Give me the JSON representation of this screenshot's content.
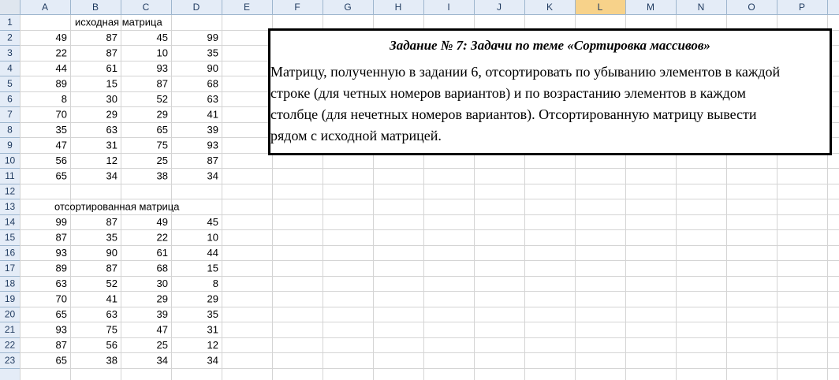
{
  "columns": [
    "A",
    "B",
    "C",
    "D",
    "E",
    "F",
    "G",
    "H",
    "I",
    "J",
    "K",
    "L",
    "M",
    "N",
    "O",
    "P"
  ],
  "selected_column": "L",
  "rows": [
    "1",
    "2",
    "3",
    "4",
    "5",
    "6",
    "7",
    "8",
    "9",
    "10",
    "11",
    "12",
    "13",
    "14",
    "15",
    "16",
    "17",
    "18",
    "19",
    "20",
    "21",
    "22",
    "23"
  ],
  "source_label": "исходная матрица",
  "source_matrix": [
    [
      49,
      87,
      45,
      99
    ],
    [
      22,
      87,
      10,
      35
    ],
    [
      44,
      61,
      93,
      90
    ],
    [
      89,
      15,
      87,
      68
    ],
    [
      8,
      30,
      52,
      63
    ],
    [
      70,
      29,
      29,
      41
    ],
    [
      35,
      63,
      65,
      39
    ],
    [
      47,
      31,
      75,
      93
    ],
    [
      56,
      12,
      25,
      87
    ],
    [
      65,
      34,
      38,
      34
    ]
  ],
  "sorted_label": "отсортированная матрица",
  "sorted_matrix": [
    [
      99,
      87,
      49,
      45
    ],
    [
      87,
      35,
      22,
      10
    ],
    [
      93,
      90,
      61,
      44
    ],
    [
      89,
      87,
      68,
      15
    ],
    [
      63,
      52,
      30,
      8
    ],
    [
      70,
      41,
      29,
      29
    ],
    [
      65,
      63,
      39,
      35
    ],
    [
      93,
      75,
      47,
      31
    ],
    [
      87,
      56,
      25,
      12
    ],
    [
      65,
      38,
      34,
      34
    ]
  ],
  "task": {
    "title": "Задание № 7: Задачи по теме «Сортировка массивов»",
    "lines": [
      "Матрицу, полученную в задании 6, отсортировать по убыванию элементов в каждой",
      "строке (для четных номеров вариантов) и по возрастанию элементов в каждом",
      "столбце (для нечетных номеров вариантов). Отсортированную матрицу вывести",
      "рядом с исходной матрицей."
    ]
  },
  "colors": {
    "header_bg": "#e4ecf7",
    "header_selected_bg": "#f7d28a",
    "gridline": "#d4d4d4",
    "header_text": "#1f3a5f"
  }
}
